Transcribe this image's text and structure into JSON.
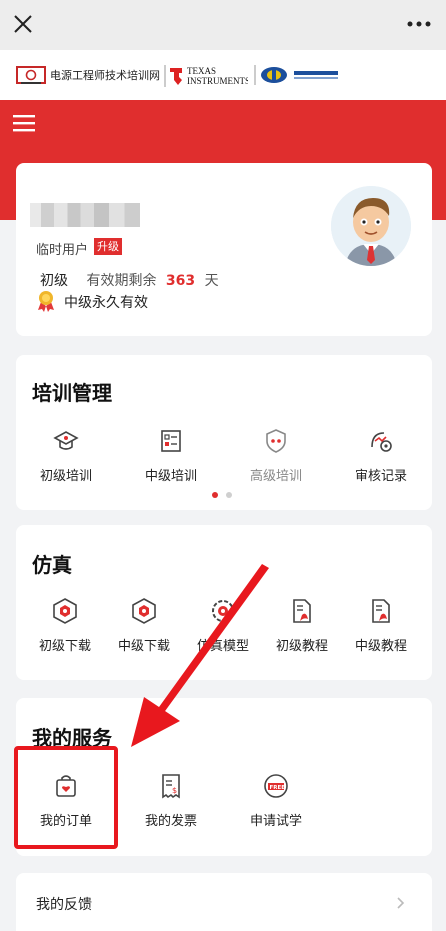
{
  "topbar": {
    "close_icon": "close-icon",
    "more_icon": "more-icon"
  },
  "brand": {
    "title": "电源工程师技术培训网",
    "ti_line1": "TEXAS",
    "ti_line2": "INSTRUMENTS"
  },
  "profile": {
    "user_type": "临时用户",
    "upgrade": "升级",
    "level": "初级",
    "validity_label": "有效期剩余",
    "days_left": "363",
    "days_unit": "天",
    "permanent_text": "中级永久有效"
  },
  "training": {
    "title": "培训管理",
    "items": [
      {
        "label": "初级培训",
        "icon": "graduation-cap-icon"
      },
      {
        "label": "中级培训",
        "icon": "checklist-icon"
      },
      {
        "label": "高级培训",
        "icon": "shield-icon",
        "dimmed": true
      },
      {
        "label": "审核记录",
        "icon": "audit-record-icon"
      }
    ]
  },
  "simulation": {
    "title": "仿真",
    "items": [
      {
        "label": "初级下载",
        "icon": "hex-nut-icon"
      },
      {
        "label": "中级下载",
        "icon": "hex-nut-icon"
      },
      {
        "label": "仿真模型",
        "icon": "gear-icon"
      },
      {
        "label": "初级教程",
        "icon": "pdf-document-icon"
      },
      {
        "label": "中级教程",
        "icon": "pdf-document-icon"
      }
    ]
  },
  "services": {
    "title": "我的服务",
    "items": [
      {
        "label": "我的订单",
        "icon": "shopping-bag-icon"
      },
      {
        "label": "我的发票",
        "icon": "invoice-icon"
      },
      {
        "label": "申请试学",
        "icon": "free-badge-icon"
      }
    ]
  },
  "feedback": {
    "label": "我的反馈"
  },
  "colors": {
    "brand_red": "#e02e2e",
    "highlight": "#e8181e",
    "background": "#f2f3f5"
  }
}
